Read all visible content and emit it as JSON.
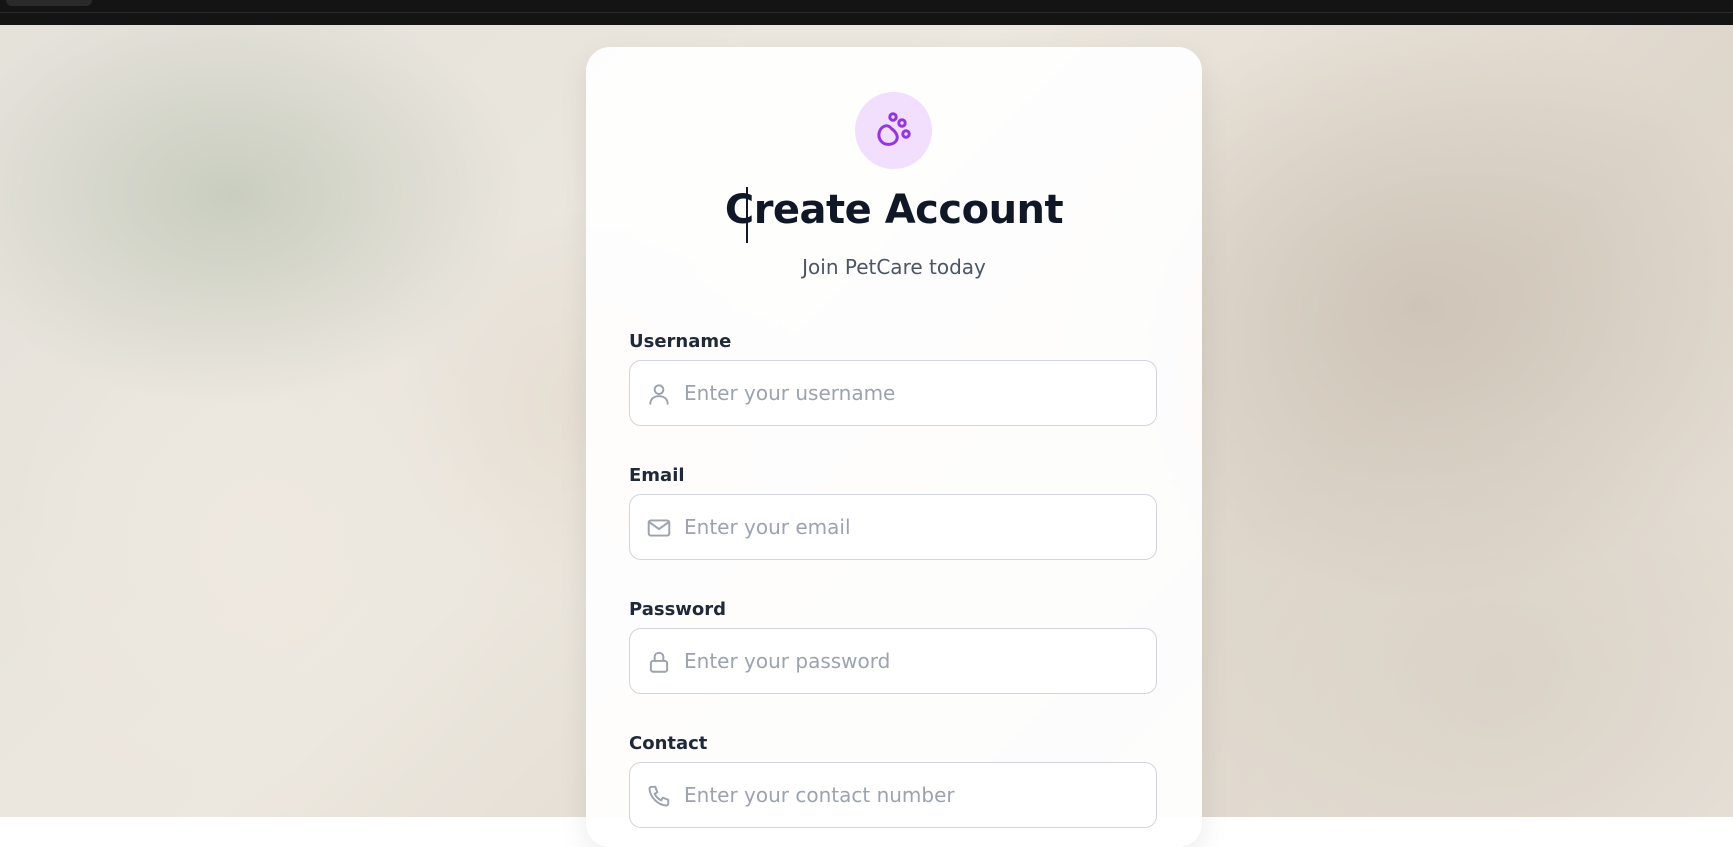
{
  "colors": {
    "accent": "#9333ea",
    "accent_light": "#f1dffd",
    "title": "#101828",
    "subtitle": "#4b5563",
    "placeholder": "#9ca3af",
    "border": "#d1d5db"
  },
  "header": {
    "logo_icon": "paw-icon",
    "title": "Create Account",
    "subtitle": "Join PetCare today"
  },
  "form": {
    "username": {
      "label": "Username",
      "placeholder": "Enter your username",
      "value": "",
      "icon": "user-icon"
    },
    "email": {
      "label": "Email",
      "placeholder": "Enter your email",
      "value": "",
      "icon": "mail-icon"
    },
    "password": {
      "label": "Password",
      "placeholder": "Enter your password",
      "value": "",
      "icon": "lock-icon"
    },
    "contact": {
      "label": "Contact",
      "placeholder": "Enter your contact number",
      "value": "",
      "icon": "phone-icon"
    }
  }
}
